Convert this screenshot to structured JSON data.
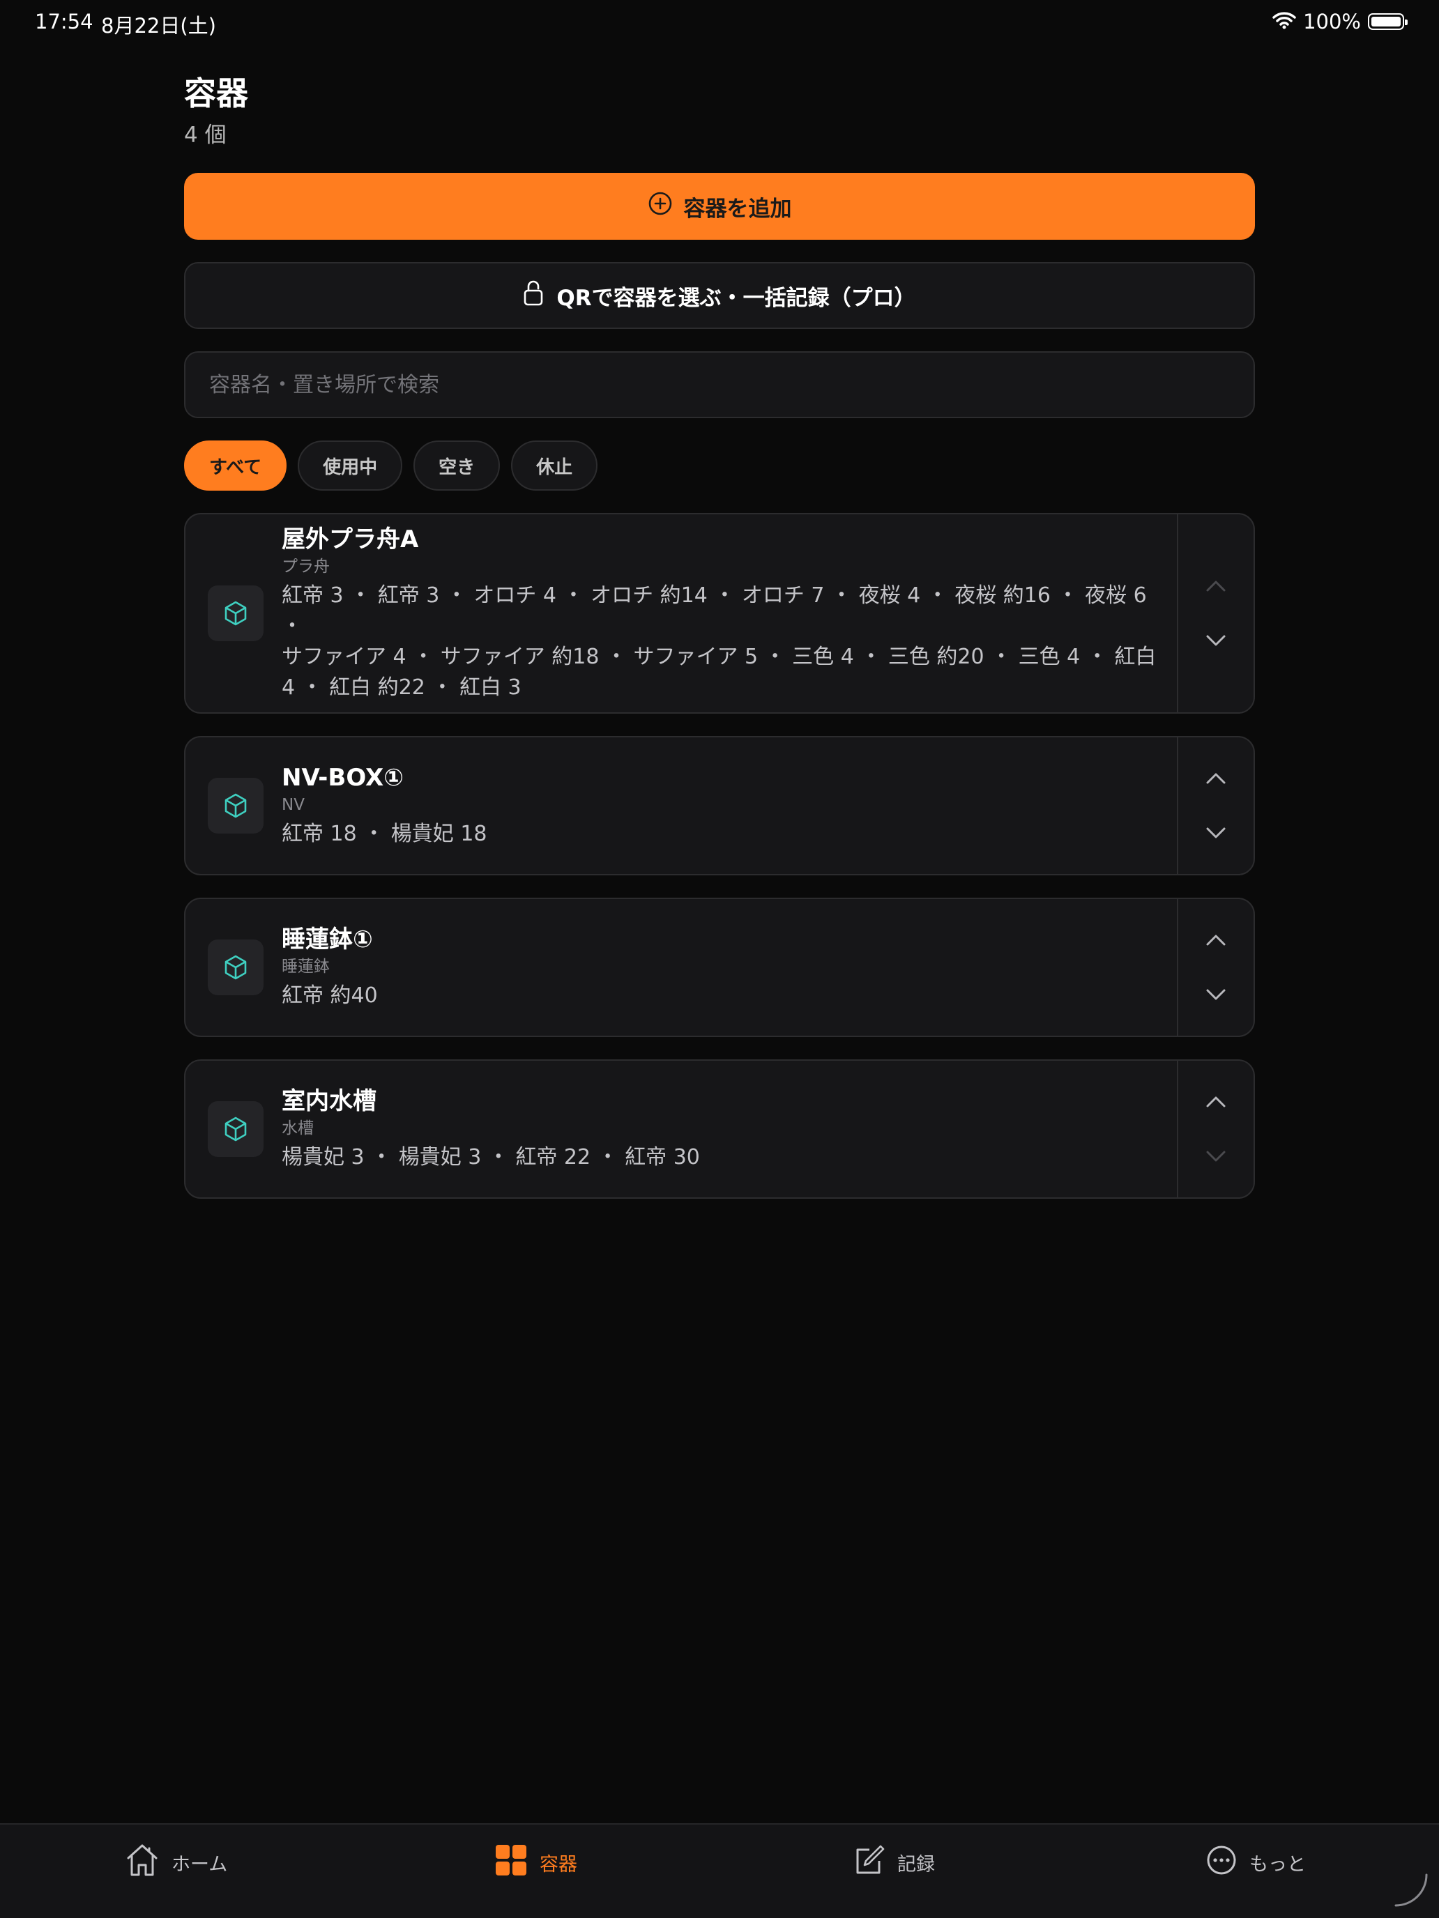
{
  "status_bar": {
    "time": "17:54",
    "date": "8月22日(土)",
    "battery": "100%"
  },
  "header": {
    "title": "容器",
    "count": "4 個"
  },
  "actions": {
    "add_label": "容器を追加",
    "qr_label": "QRで容器を選ぶ・一括記録（プロ）"
  },
  "search": {
    "placeholder": "容器名・置き場所で検索",
    "value": ""
  },
  "filters": [
    {
      "label": "すべて",
      "active": true
    },
    {
      "label": "使用中",
      "active": false
    },
    {
      "label": "空き",
      "active": false
    },
    {
      "label": "休止",
      "active": false
    }
  ],
  "containers": [
    {
      "name": "屋外プラ舟A",
      "type": "プラ舟",
      "fish_lines": [
        "紅帝 3 ・ 紅帝 3 ・ オロチ 4 ・ オロチ 約14 ・ オロチ 7 ・ 夜桜 4 ・ 夜桜 約16 ・ 夜桜 6 ・",
        "サファイア 4 ・ サファイア 約18 ・ サファイア 5 ・ 三色 4 ・ 三色 約20 ・ 三色 4 ・ 紅白",
        "4 ・ 紅白 約22 ・ 紅白 3"
      ],
      "can_move_up": false,
      "can_move_down": true
    },
    {
      "name": "NV-BOX①",
      "type": "NV",
      "fish_lines": [
        "紅帝 18 ・ 楊貴妃 18"
      ],
      "can_move_up": true,
      "can_move_down": true
    },
    {
      "name": "睡蓮鉢①",
      "type": "睡蓮鉢",
      "fish_lines": [
        "紅帝 約40"
      ],
      "can_move_up": true,
      "can_move_down": true
    },
    {
      "name": "室内水槽",
      "type": "水槽",
      "fish_lines": [
        "楊貴妃 3 ・ 楊貴妃 3 ・ 紅帝 22 ・ 紅帝 30"
      ],
      "can_move_up": true,
      "can_move_down": false
    }
  ],
  "tabs": [
    {
      "label": "ホーム",
      "icon": "home-icon",
      "active": false
    },
    {
      "label": "容器",
      "icon": "grid-icon",
      "active": true
    },
    {
      "label": "記録",
      "icon": "edit-icon",
      "active": false
    },
    {
      "label": "もっと",
      "icon": "more-icon",
      "active": false
    }
  ],
  "colors": {
    "accent": "#ff7d1f",
    "background": "#0a0a0a",
    "card": "#161618",
    "icon_teal": "#3fd0c1"
  }
}
